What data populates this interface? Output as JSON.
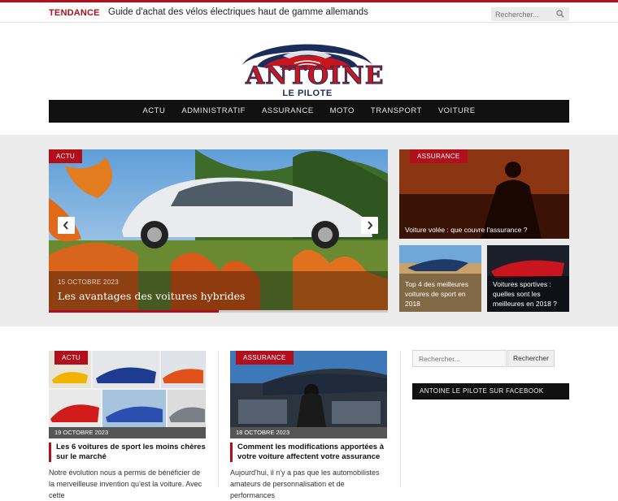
{
  "topbar": {
    "trend_label": "TENDANCE",
    "trend_text": "Guide d'achat des vélos électriques haut de gamme allemands",
    "search_placeholder": "Rechercher..."
  },
  "logo": {
    "title": "ANTOINE",
    "subtitle": "LE PILOTE"
  },
  "nav": {
    "items": [
      "ACTU",
      "ADMINISTRATIF",
      "ASSURANCE",
      "MOTO",
      "TRANSPORT",
      "VOITURE"
    ]
  },
  "slider": {
    "category": "ACTU",
    "date": "15 OCTOBRE 2023",
    "title": "Les avantages des voitures hybrides",
    "progress": 0.5
  },
  "side_cards": [
    {
      "category": "ASSURANCE",
      "title": "Voiture volée : que couvre l'assurance ?"
    },
    {
      "title": "Top 4 des meilleures voitures de sport en 2018"
    },
    {
      "title": "Voitures sportives : quelles sont les meilleures en 2018 ?"
    }
  ],
  "posts": [
    {
      "category": "ACTU",
      "date": "19 OCTOBRE 2023",
      "title": "Les 6 voitures de sport les moins chères sur le marché",
      "excerpt": "Notre évolution nous a permis de bénéficier de la merveilleuse invention qu'est la voiture. Avec cette"
    },
    {
      "category": "ASSURANCE",
      "date": "18 OCTOBRE 2023",
      "title": "Comment les modifications apportées à votre voiture affectent votre assurance",
      "excerpt": "Aujourd'hui, il n'y a pas que les automobilistes amateurs de personnalisation et de performances"
    }
  ],
  "sidebar": {
    "search_placeholder": "Rechercher...",
    "search_button": "Rechercher",
    "facebook_title": "ANTOINE LE PILOTE SUR FACEBOOK"
  },
  "colors": {
    "accent": "#b10f1b",
    "nav_bg": "#111111"
  }
}
